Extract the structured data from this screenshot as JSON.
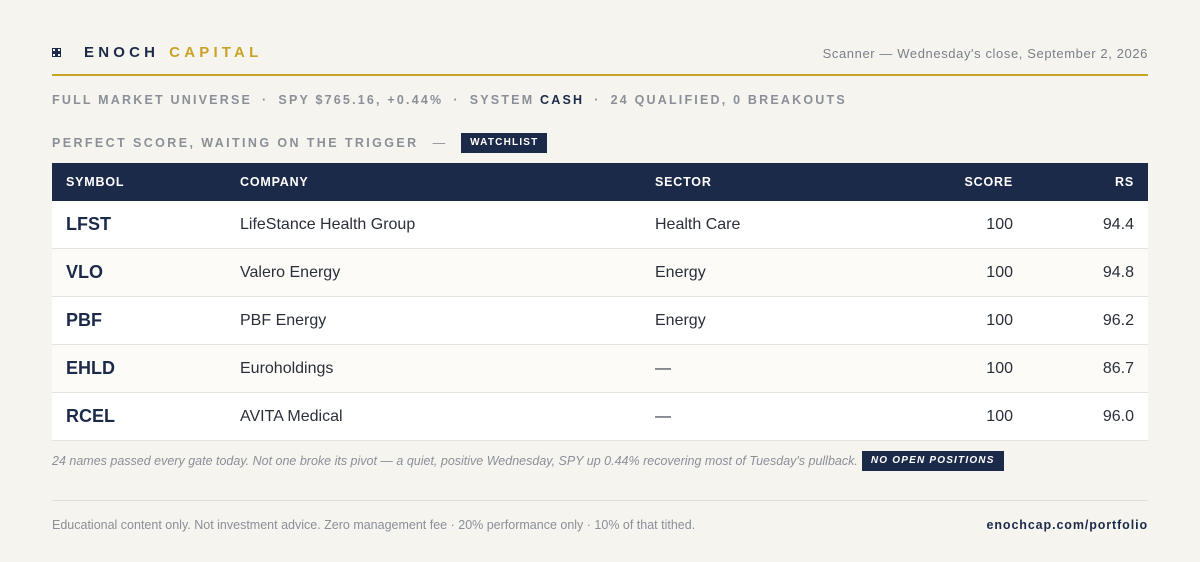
{
  "brand": {
    "icon": "cross-emblem-icon",
    "name": "ENOCH",
    "accent": "CAPITAL",
    "accent_color": "#c9a227"
  },
  "scan_date": "Scanner — Wednesday's close, September 2, 2026",
  "status": {
    "universe": "FULL MARKET UNIVERSE",
    "spy": "SPY $765.16, +0.44%",
    "system_label": "SYSTEM",
    "system_state": "CASH",
    "counts": "24 QUALIFIED, 0 BREAKOUTS",
    "separator": "·"
  },
  "watchlist": {
    "title": "PERFECT SCORE, WAITING ON THE TRIGGER",
    "dash": "—",
    "badge": "WATCHLIST"
  },
  "table": {
    "headers": {
      "symbol": "SYMBOL",
      "company": "COMPANY",
      "sector": "SECTOR",
      "score": "SCORE",
      "rs": "RS"
    },
    "rows": [
      {
        "symbol": "LFST",
        "company": "LifeStance Health Group",
        "sector": "Health Care",
        "score": "100",
        "rs": "94.4"
      },
      {
        "symbol": "VLO",
        "company": "Valero Energy",
        "sector": "Energy",
        "score": "100",
        "rs": "94.8"
      },
      {
        "symbol": "PBF",
        "company": "PBF Energy",
        "sector": "Energy",
        "score": "100",
        "rs": "96.2"
      },
      {
        "symbol": "EHLD",
        "company": "Euroholdings",
        "sector": "—",
        "score": "100",
        "rs": "86.7"
      },
      {
        "symbol": "RCEL",
        "company": "AVITA Medical",
        "sector": "—",
        "score": "100",
        "rs": "96.0"
      }
    ]
  },
  "note": {
    "text": "24 names passed every gate today. Not one broke its pivot — a quiet, positive Wednesday, SPY up 0.44% recovering most of Tuesday's pullback.",
    "badge": "NO OPEN POSITIONS"
  },
  "footer": {
    "disclaimer": "Educational content only. Not investment advice. Zero management fee · 20% performance only · 10% of that tithed.",
    "link": "enochcap.com/portfolio"
  },
  "colors": {
    "navy": "#1c2a4a",
    "gold": "#c9a227",
    "background": "#f6f4ef",
    "muted": "#8a8f98"
  }
}
